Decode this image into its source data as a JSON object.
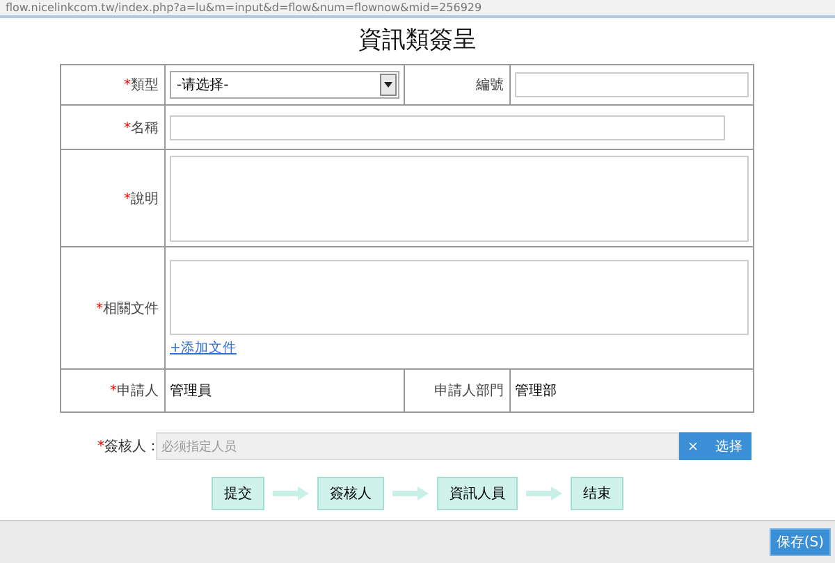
{
  "address_bar": {
    "url": "flow.nicelinkcom.tw/index.php?a=lu&m=input&d=flow&num=flownow&mid=256929"
  },
  "title": "資訊類簽呈",
  "form_rows": [
    {
      "cells": [
        {
          "mark": "*",
          "label": "類型",
          "kind": "select",
          "value": "-请选择-"
        },
        {
          "label": "編號",
          "kind": "input"
        }
      ]
    },
    {
      "cells": [
        {
          "mark": "*",
          "label": "名稱",
          "kind": "input"
        }
      ]
    },
    {
      "cells": [
        {
          "mark": "*",
          "label": "說明",
          "kind": "textarea"
        }
      ]
    },
    {
      "cells": [
        {
          "mark": "*",
          "label": "相關文件",
          "kind": "files",
          "link": "+添加文件"
        }
      ]
    },
    {
      "cells": [
        {
          "mark": "*",
          "label": "申請人",
          "kind": "text",
          "value": "管理員"
        },
        {
          "label": "申請人部門",
          "kind": "text",
          "value": "管理部"
        }
      ]
    }
  ],
  "approver": {
    "mark": "*",
    "label": "簽核人：",
    "placeholder": "必须指定人员",
    "clear": "×",
    "select": "选择"
  },
  "flow_steps": [
    "提交",
    "簽核人",
    "資訊人員",
    "结束"
  ],
  "footer": {
    "save": "保存(S)"
  }
}
